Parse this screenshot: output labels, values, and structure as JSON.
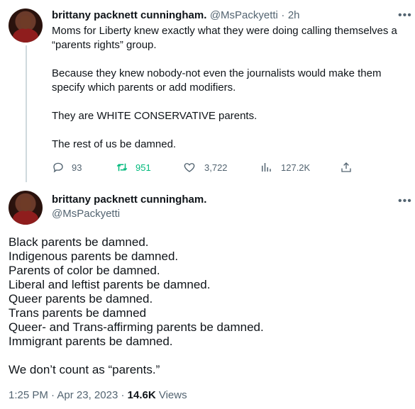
{
  "tweet1": {
    "author_name": "brittany packnett cunningham.",
    "handle": "@MsPackyetti",
    "separator": "·",
    "time_ago": "2h",
    "text": "Moms for Liberty knew exactly what they were doing calling themselves a “parents rights” group.\n\nBecause they knew nobody-not even the journalists would make them specify which parents or add modifiers.\n\nThey are WHITE CONSERVATIVE parents.\n\nThe rest of us be damned.",
    "replies": "93",
    "retweets": "951",
    "likes": "3,722",
    "views": "127.2K",
    "more_icon": "more-horizontal-icon"
  },
  "tweet2": {
    "author_name": "brittany packnett cunningham.",
    "handle": "@MsPackyetti",
    "text": "Black parents be damned.\nIndigenous parents be damned.\nParents of color be damned.\nLiberal and leftist parents be damned.\nQueer parents be damned.\nTrans parents be damned\nQueer- and Trans-affirming parents be damned.\nImmigrant parents be damned.\n\nWe don’t count as “parents.”",
    "time": "1:25 PM",
    "dot1": "·",
    "date": "Apr 23, 2023",
    "dot2": "·",
    "views_count": "14.6K",
    "views_label": "Views"
  },
  "colors": {
    "text": "#0f1419",
    "secondary": "#536471",
    "retweet_active": "#00ba7c",
    "thread_line": "#cfd9de"
  }
}
